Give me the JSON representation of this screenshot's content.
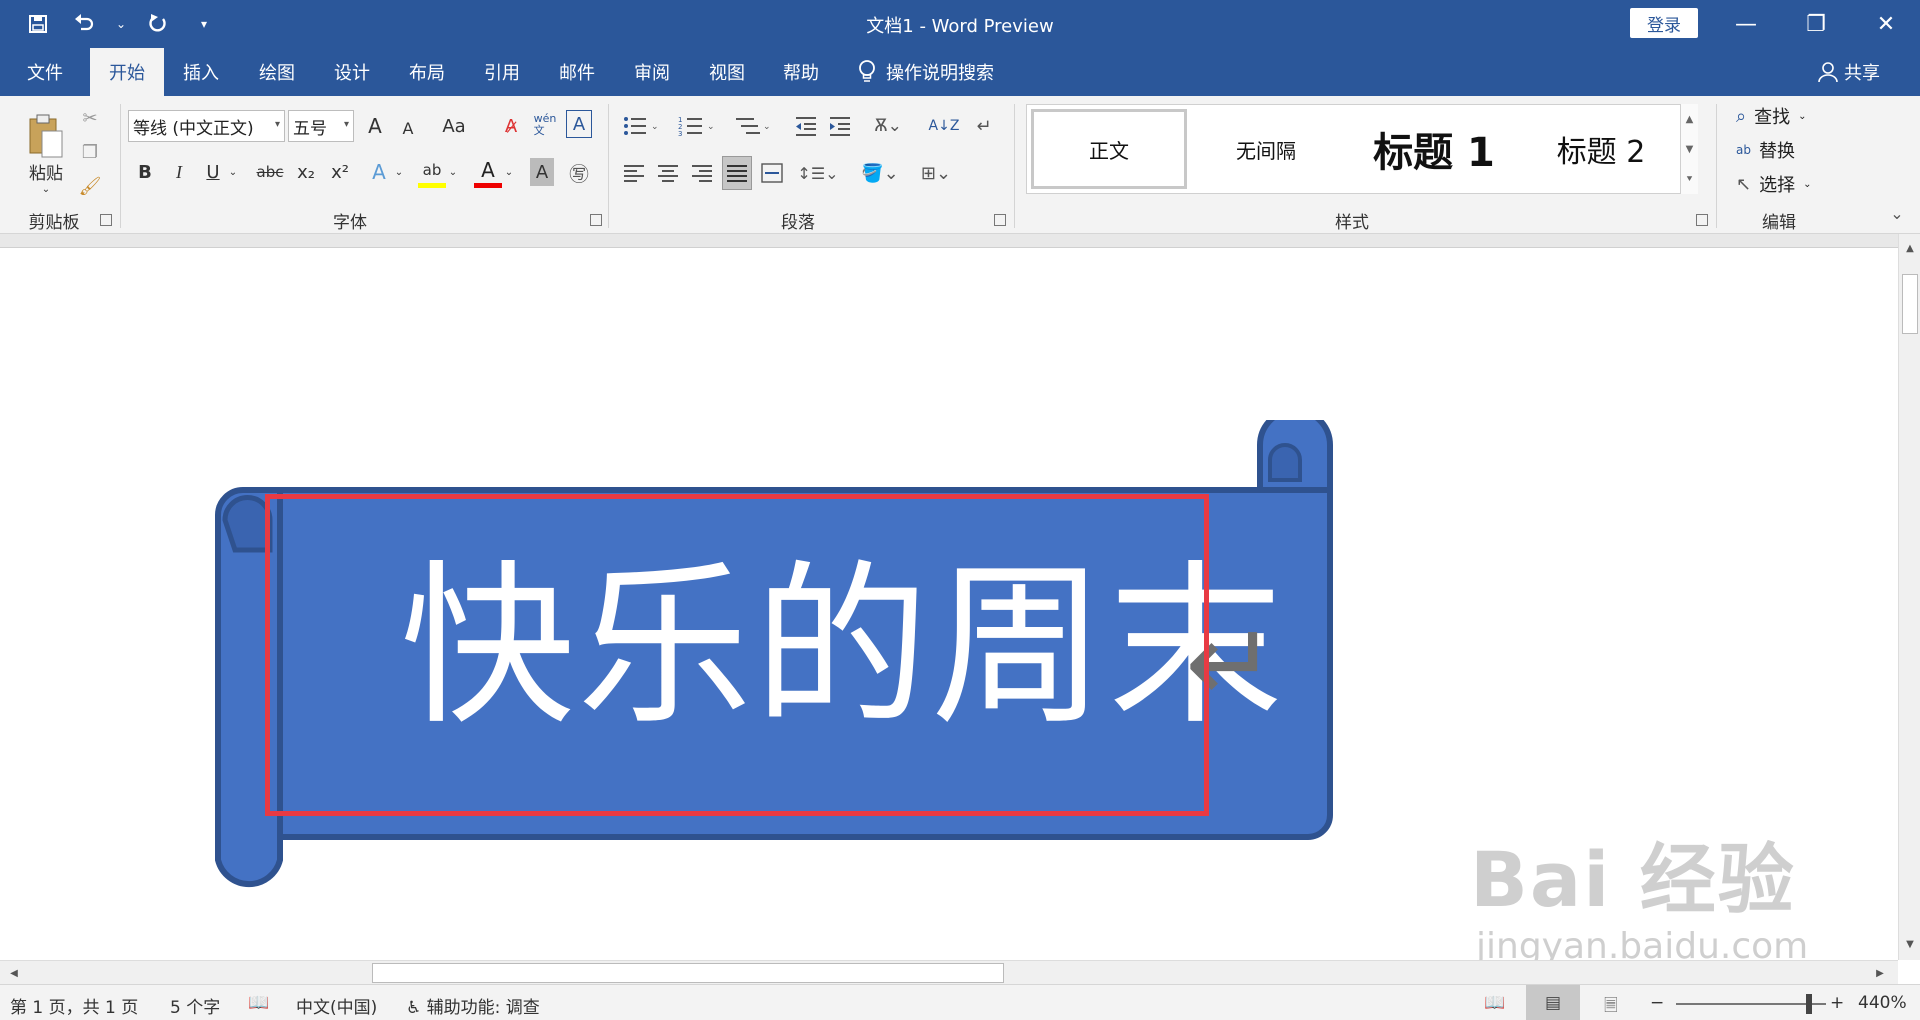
{
  "titlebar": {
    "title": "文档1  -  Word Preview",
    "login": "登录",
    "minimize": "—",
    "restore": "❐",
    "close": "✕"
  },
  "qat": {
    "save": "💾",
    "undo": "↶",
    "undo_dd": "⌄",
    "redo": "↻",
    "customize": "▾"
  },
  "tabs": [
    "文件",
    "开始",
    "插入",
    "绘图",
    "设计",
    "布局",
    "引用",
    "邮件",
    "审阅",
    "视图",
    "帮助"
  ],
  "tell_me": "操作说明搜索",
  "share": "共享",
  "ribbon": {
    "clipboard": {
      "label": "剪贴板",
      "paste": "粘贴"
    },
    "font": {
      "label": "字体",
      "font_name": "等线 (中文正文)",
      "font_size": "五号",
      "grow": "A",
      "shrink": "A",
      "case": "Aa",
      "phonetic": "wén\n文",
      "border_char": "A",
      "bold": "B",
      "italic": "I",
      "underline": "U",
      "strike": "abc",
      "subscript": "x₂",
      "superscript": "x²",
      "text_effect": "A",
      "highlight": "ab",
      "font_color": "A",
      "shade_char": "A",
      "enclose": "㊢"
    },
    "paragraph": {
      "label": "段落"
    },
    "styles": {
      "label": "样式",
      "items": [
        "正文",
        "无间隔",
        "标题 1",
        "标题 2"
      ]
    },
    "editing": {
      "label": "编辑",
      "find": "查找",
      "replace": "替换",
      "select": "选择"
    }
  },
  "document": {
    "shape_text": "快乐的周末",
    "paragraph_mark": "↵",
    "shape_color": "#4472c4",
    "shape_border": "#2f528f",
    "highlight_color": "#e83a43"
  },
  "watermark": {
    "brand": "Bai 经验",
    "url": "jingyan.baidu.com"
  },
  "statusbar": {
    "page": "第 1 页，共 1 页",
    "words": "5 个字",
    "lang": "中文(中国)",
    "accessibility": "辅助功能: 调查",
    "zoom": "440%",
    "zoom_minus": "−",
    "zoom_plus": "+"
  }
}
